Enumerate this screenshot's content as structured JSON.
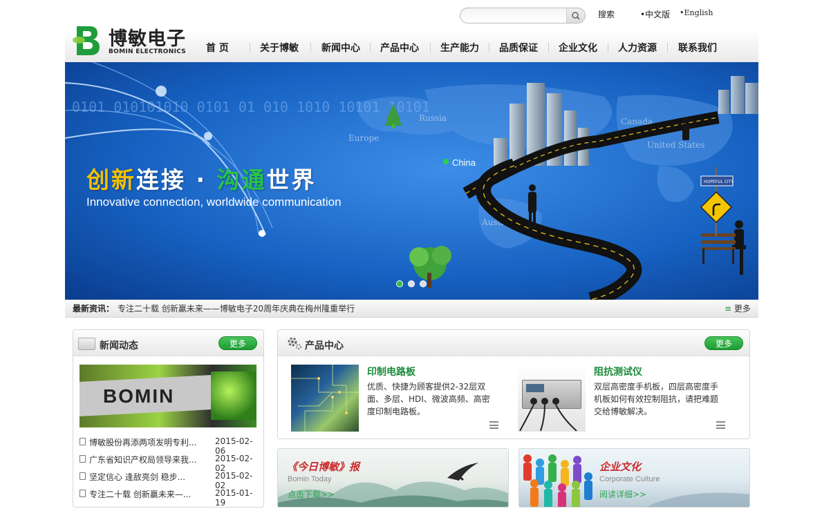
{
  "topbar": {
    "search_placeholder": "",
    "search_label": "搜索",
    "lang_cn": "•中文版",
    "lang_en": "•English"
  },
  "logo": {
    "mark": "B",
    "cn": "博敏电子",
    "en": "BOMIN ELECTRONICS"
  },
  "nav": [
    "首 页",
    "关于博敏",
    "新闻中心",
    "产品中心",
    "生产能力",
    "品质保证",
    "企业文化",
    "人力资源",
    "联系我们"
  ],
  "banner": {
    "headline_parts": [
      "创",
      "新",
      "连接 · ",
      "沟",
      "通",
      "世界"
    ],
    "subline": "Innovative connection, worldwide communication",
    "map_labels": {
      "russia": "Russia",
      "europe": "Europe",
      "china": "China",
      "canada": "Canada",
      "usa": "United States",
      "australia": "Australia"
    },
    "binary_text": "0101 010101010 0101 01 010 1010 10101 10101",
    "sign_text": "HOPEFUL CITY",
    "slide_count": 3,
    "active_slide": 1
  },
  "newsbar": {
    "label": "最新资讯：",
    "text": "专注二十载  创新赢未来——博敏电子20周年庆典在梅州隆重举行",
    "more": "更多"
  },
  "news": {
    "title": "新闻动态",
    "more": "更多",
    "image_text": "BOMIN",
    "items": [
      {
        "title": "博敏股份再添两项发明专利...",
        "date": "2015-02-06"
      },
      {
        "title": "广东省知识产权局领导来我...",
        "date": "2015-02-02"
      },
      {
        "title": "坚定信心 逢敌亮剑 稳步...",
        "date": "2015-02-02"
      },
      {
        "title": "专注二十载 创新赢未来—...",
        "date": "2015-01-19"
      }
    ]
  },
  "products": {
    "title": "产品中心",
    "more": "更多",
    "items": [
      {
        "name": "印制电路板",
        "desc": "优质、快捷为顾客提供2-32层双面、多层、HDI、微波高频、高密度印制电路板。"
      },
      {
        "name": "阻抗测试仪",
        "desc": "双层高密度手机板，四层高密度手机板如何有效控制阻抗，请把难题交给博敏解决。"
      }
    ]
  },
  "promos": [
    {
      "title": "《今日博敏》报",
      "subtitle": "Bomin Today",
      "link": "点击下载>>"
    },
    {
      "title": "企业文化",
      "subtitle": "Corporate Culture",
      "link": "阅读详细>>"
    }
  ],
  "colors": {
    "brand_green": "#1d9c33",
    "banner_blue": "#1565c8",
    "headline_yellow": "#f2c100",
    "headline_green": "#22b14c"
  }
}
